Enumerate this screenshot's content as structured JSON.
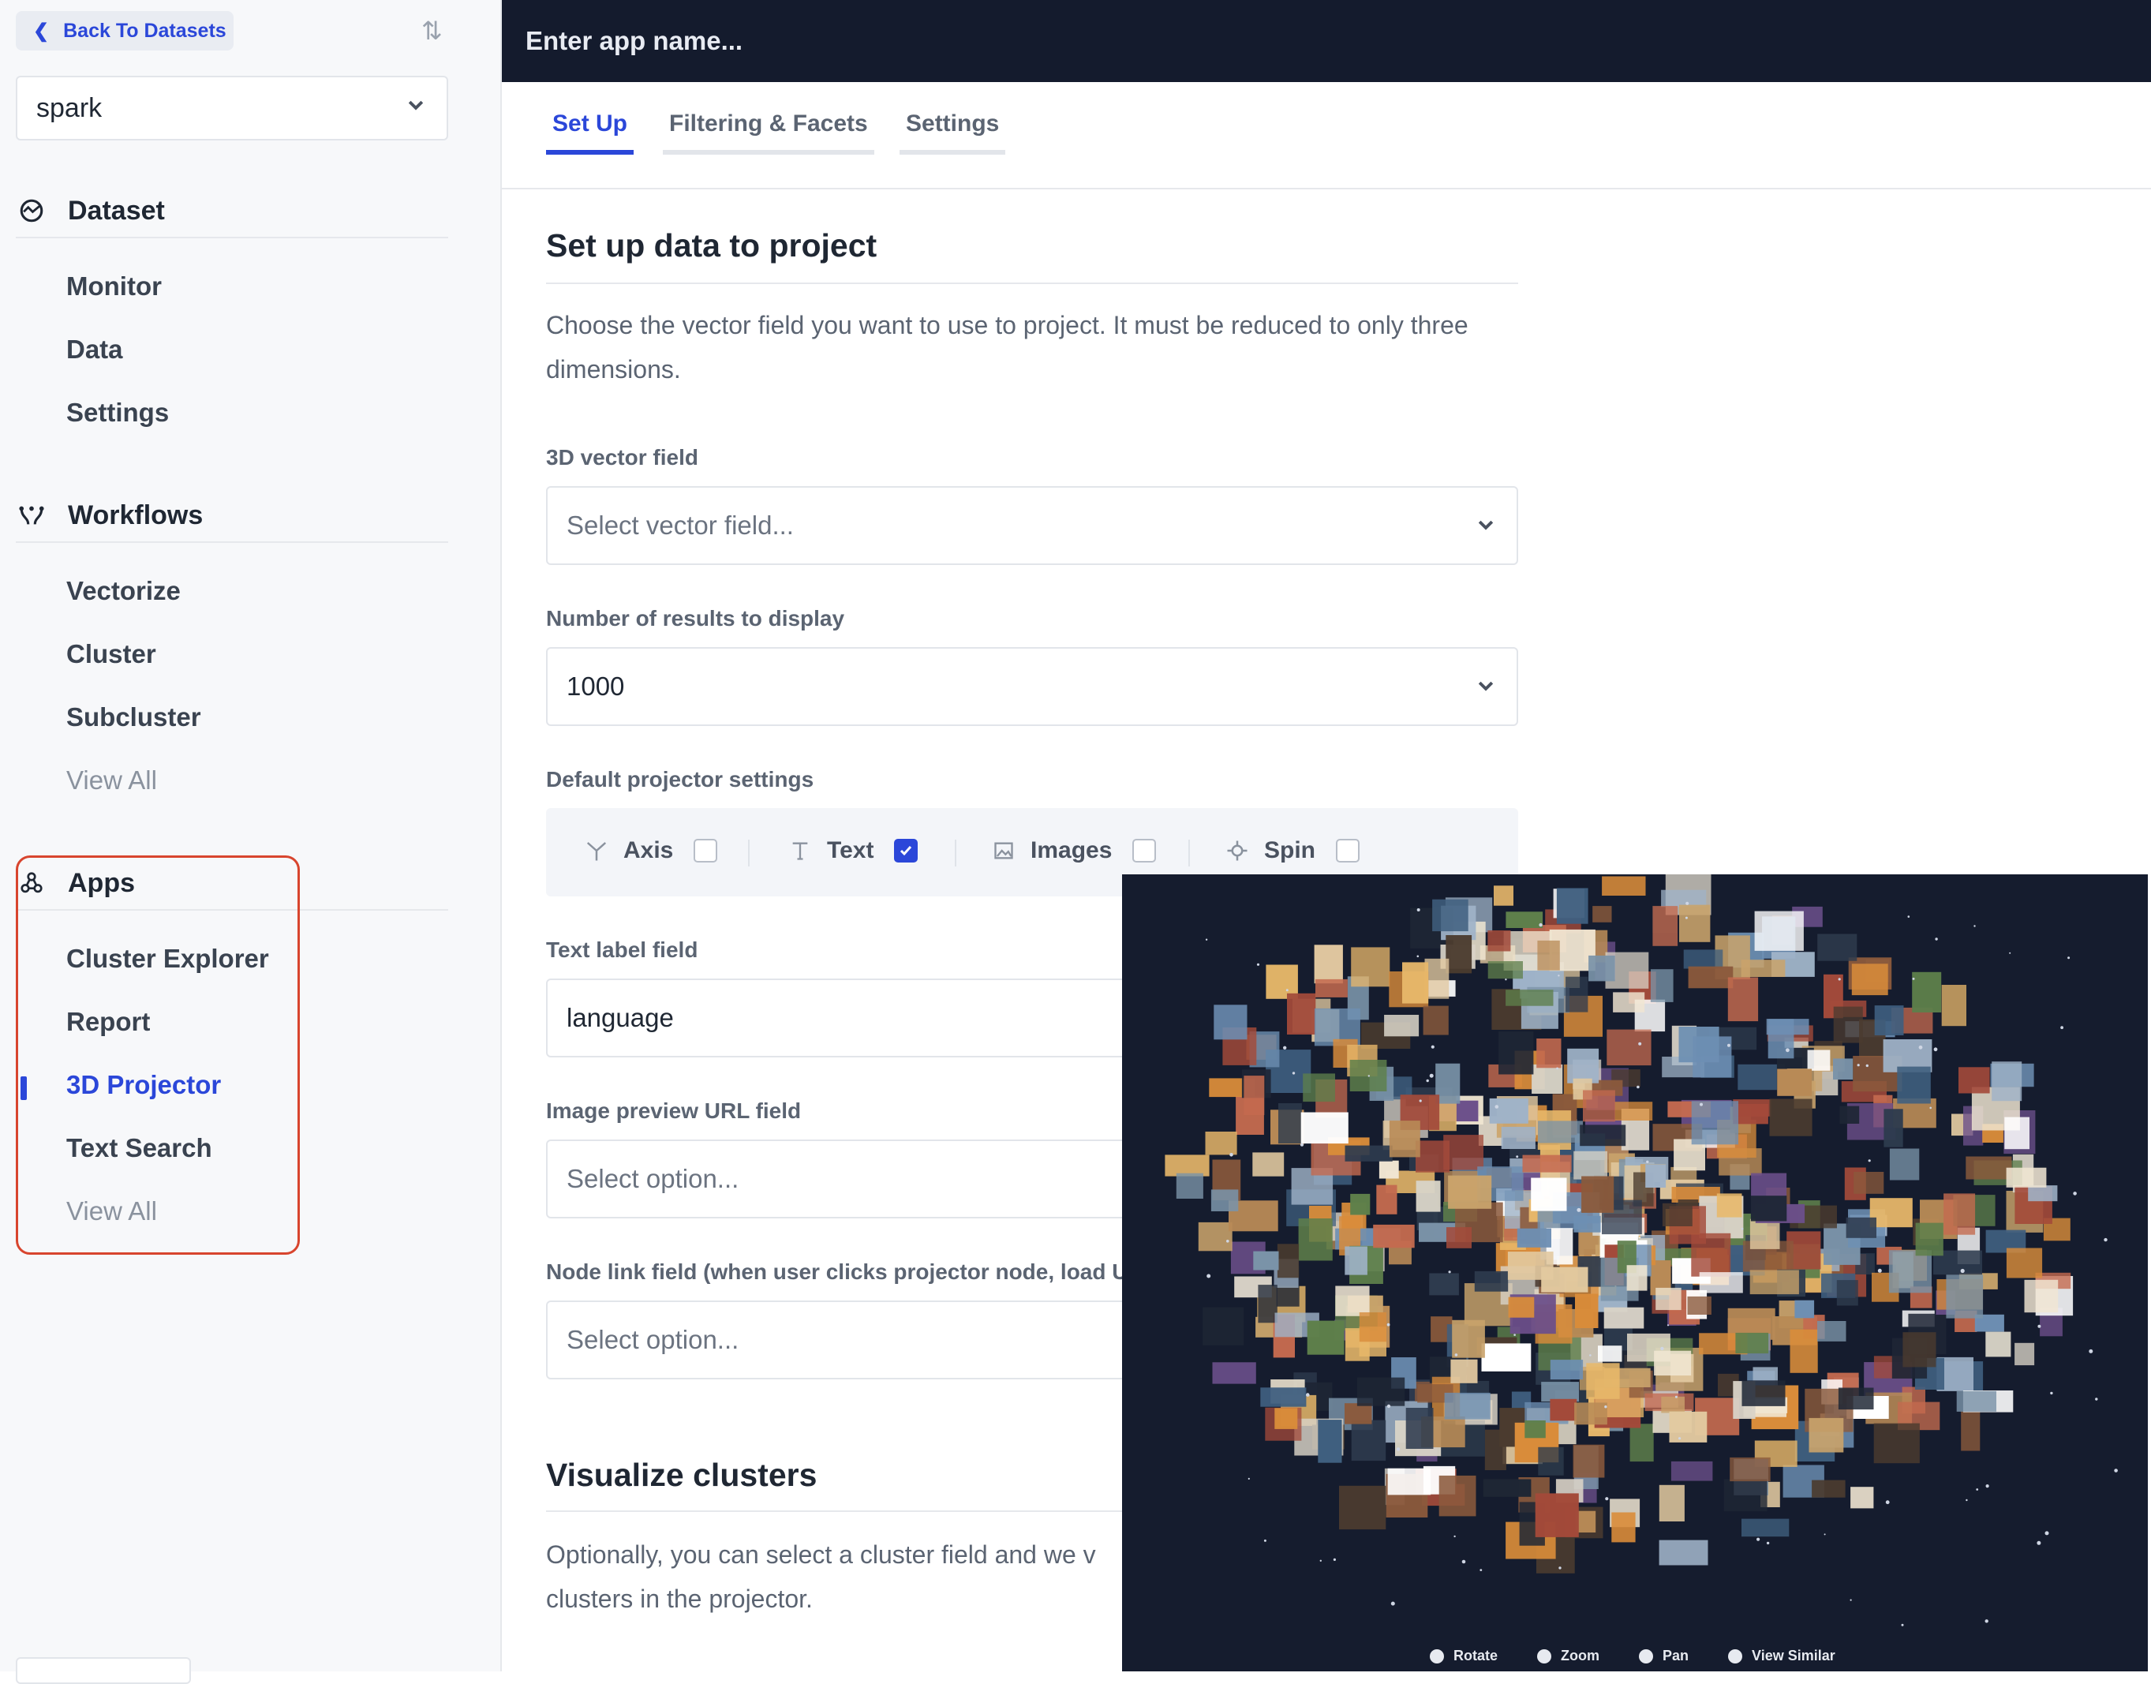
{
  "sidebar": {
    "back_label": "Back To Datasets",
    "dataset_selected": "spark",
    "sections": {
      "dataset": {
        "title": "Dataset",
        "items": [
          "Monitor",
          "Data",
          "Settings"
        ]
      },
      "workflows": {
        "title": "Workflows",
        "items": [
          "Vectorize",
          "Cluster",
          "Subcluster",
          "View All"
        ]
      },
      "apps": {
        "title": "Apps",
        "items": [
          "Cluster Explorer",
          "Report",
          "3D Projector",
          "Text Search",
          "View All"
        ],
        "active": "3D Projector"
      }
    }
  },
  "header": {
    "app_name_placeholder": "Enter app name..."
  },
  "tabs": [
    {
      "label": "Set Up",
      "active": true
    },
    {
      "label": "Filtering & Facets",
      "active": false
    },
    {
      "label": "Settings",
      "active": false
    }
  ],
  "setup": {
    "title": "Set up data to project",
    "description": "Choose the vector field you want to use to project. It must be reduced to only three dimensions.",
    "vector_field_label": "3D vector field",
    "vector_field_placeholder": "Select vector field...",
    "results_label": "Number of results to display",
    "results_value": "1000",
    "defaults_label": "Default projector settings",
    "toggles": [
      {
        "label": "Axis",
        "checked": false,
        "icon": "axis-icon"
      },
      {
        "label": "Text",
        "checked": true,
        "icon": "text-icon"
      },
      {
        "label": "Images",
        "checked": false,
        "icon": "image-icon"
      },
      {
        "label": "Spin",
        "checked": false,
        "icon": "spin-icon"
      }
    ],
    "text_label_field_label": "Text label field",
    "text_label_field_value": "language",
    "image_url_label": "Image preview URL field",
    "image_url_placeholder": "Select option...",
    "node_link_label": "Node link field (when user clicks projector node, load UR",
    "node_link_placeholder": "Select option..."
  },
  "clusters": {
    "title": "Visualize clusters",
    "description": "Optionally, you can select a cluster field and we v clusters in the projector."
  },
  "projector": {
    "controls": [
      "Rotate",
      "Zoom",
      "Pan",
      "View Similar"
    ],
    "background": "#151c2e"
  },
  "colors": {
    "accent": "#2b47d9",
    "highlight": "#d8452e",
    "topbar": "#141b2d"
  }
}
